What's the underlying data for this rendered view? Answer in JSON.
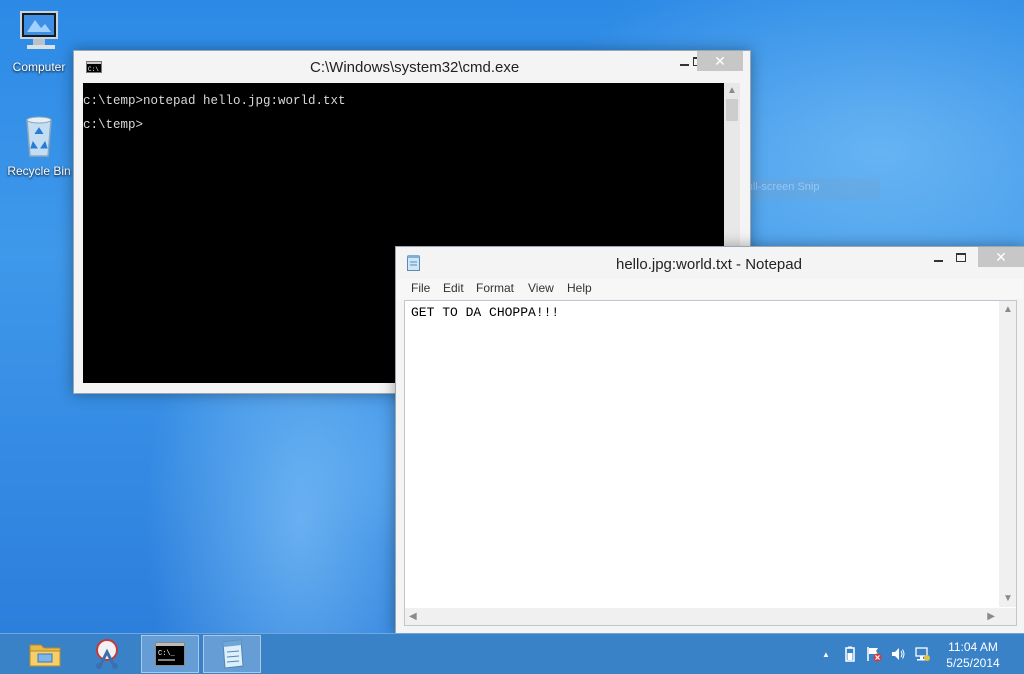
{
  "desktop": {
    "icons": [
      {
        "label": "Computer",
        "icon": "computer-icon"
      },
      {
        "label": "Recycle Bin",
        "icon": "recycle-bin-icon"
      }
    ],
    "snip_ghost_label": "Full-screen Snip"
  },
  "cmd": {
    "title": "C:\\Windows\\system32\\cmd.exe",
    "lines": [
      "c:\\temp>notepad hello.jpg:world.txt",
      "c:\\temp>"
    ],
    "close_glyph": "✕"
  },
  "notepad": {
    "title": "hello.jpg:world.txt - Notepad",
    "menu": [
      "File",
      "Edit",
      "Format",
      "View",
      "Help"
    ],
    "content": "GET TO DA CHOPPA!!!",
    "close_glyph": "✕"
  },
  "taskbar": {
    "buttons": [
      {
        "name": "file-explorer",
        "active": false
      },
      {
        "name": "snipping-tool",
        "active": false
      },
      {
        "name": "command-prompt",
        "active": true
      },
      {
        "name": "notepad",
        "active": true
      }
    ],
    "tray": {
      "show_hidden_glyph": "▲",
      "clock_time": "11:04 AM",
      "clock_date": "5/25/2014"
    }
  },
  "colors": {
    "accent": "#3a82c8",
    "console_bg": "#000000",
    "console_text": "#d8d8d8"
  }
}
